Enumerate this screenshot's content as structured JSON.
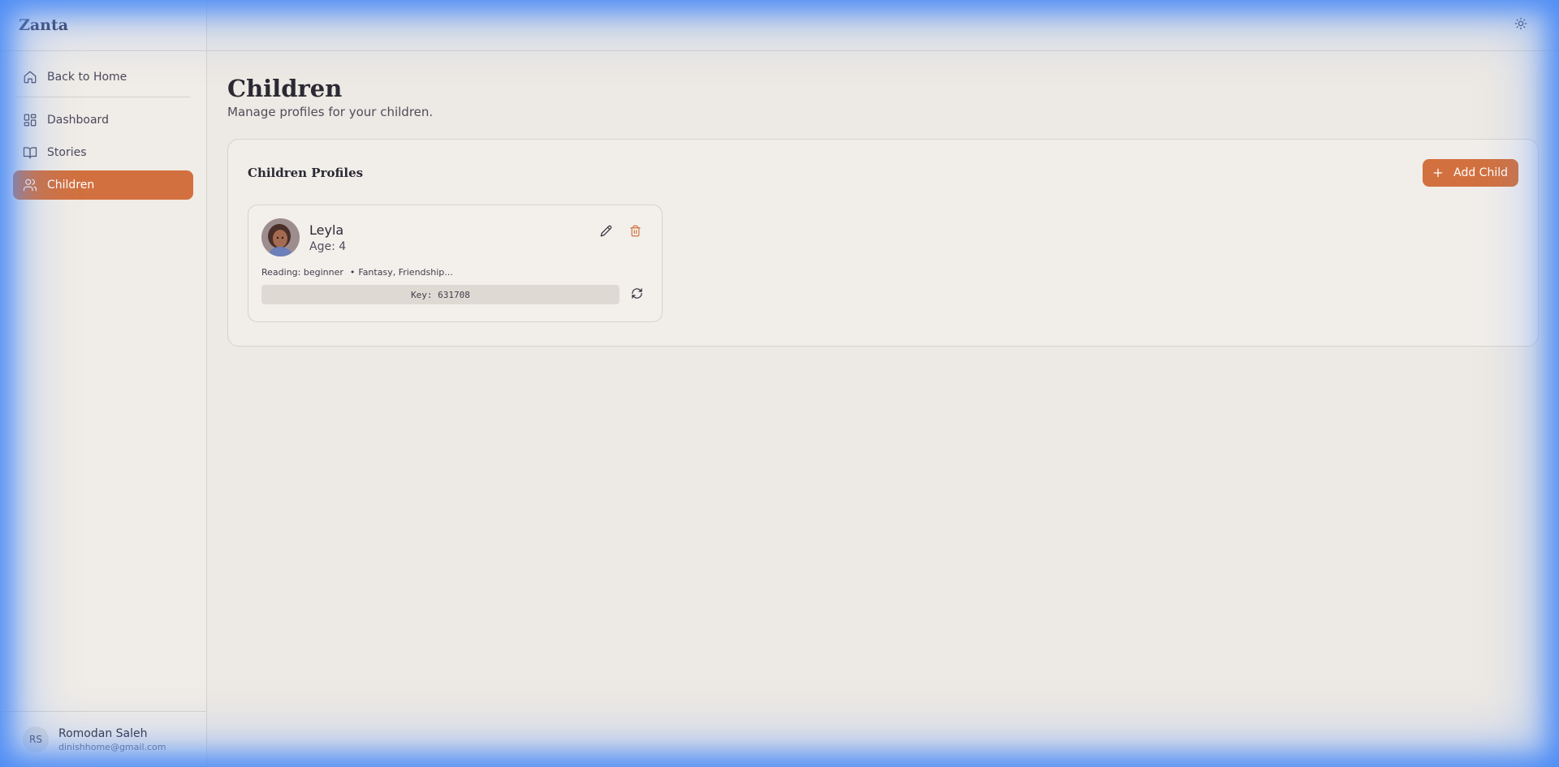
{
  "app": {
    "brand": "Zanta"
  },
  "sidebar": {
    "back": {
      "label": "Back to Home",
      "icon": "home-icon"
    },
    "items": [
      {
        "label": "Dashboard",
        "icon": "dashboard-icon",
        "active": false
      },
      {
        "label": "Stories",
        "icon": "book-icon",
        "active": false
      },
      {
        "label": "Children",
        "icon": "users-icon",
        "active": true
      }
    ]
  },
  "user": {
    "initials": "RS",
    "name": "Romodan Saleh",
    "email": "dinishhome@gmail.com"
  },
  "header": {
    "theme_toggle_icon": "sun-icon"
  },
  "page": {
    "title": "Children",
    "subtitle": "Manage profiles for your children."
  },
  "profiles_card": {
    "title": "Children Profiles",
    "add_button": "Add Child",
    "children": [
      {
        "name": "Leyla",
        "age": "Age: 4",
        "reading": "Reading: beginner",
        "interests": "Fantasy, Friendship...",
        "key": "Key: 631708"
      }
    ]
  },
  "colors": {
    "accent": "#d2713f",
    "background": "#ede9e4",
    "sidebar": "#f0ece7",
    "glow": "#4d8cf5"
  }
}
